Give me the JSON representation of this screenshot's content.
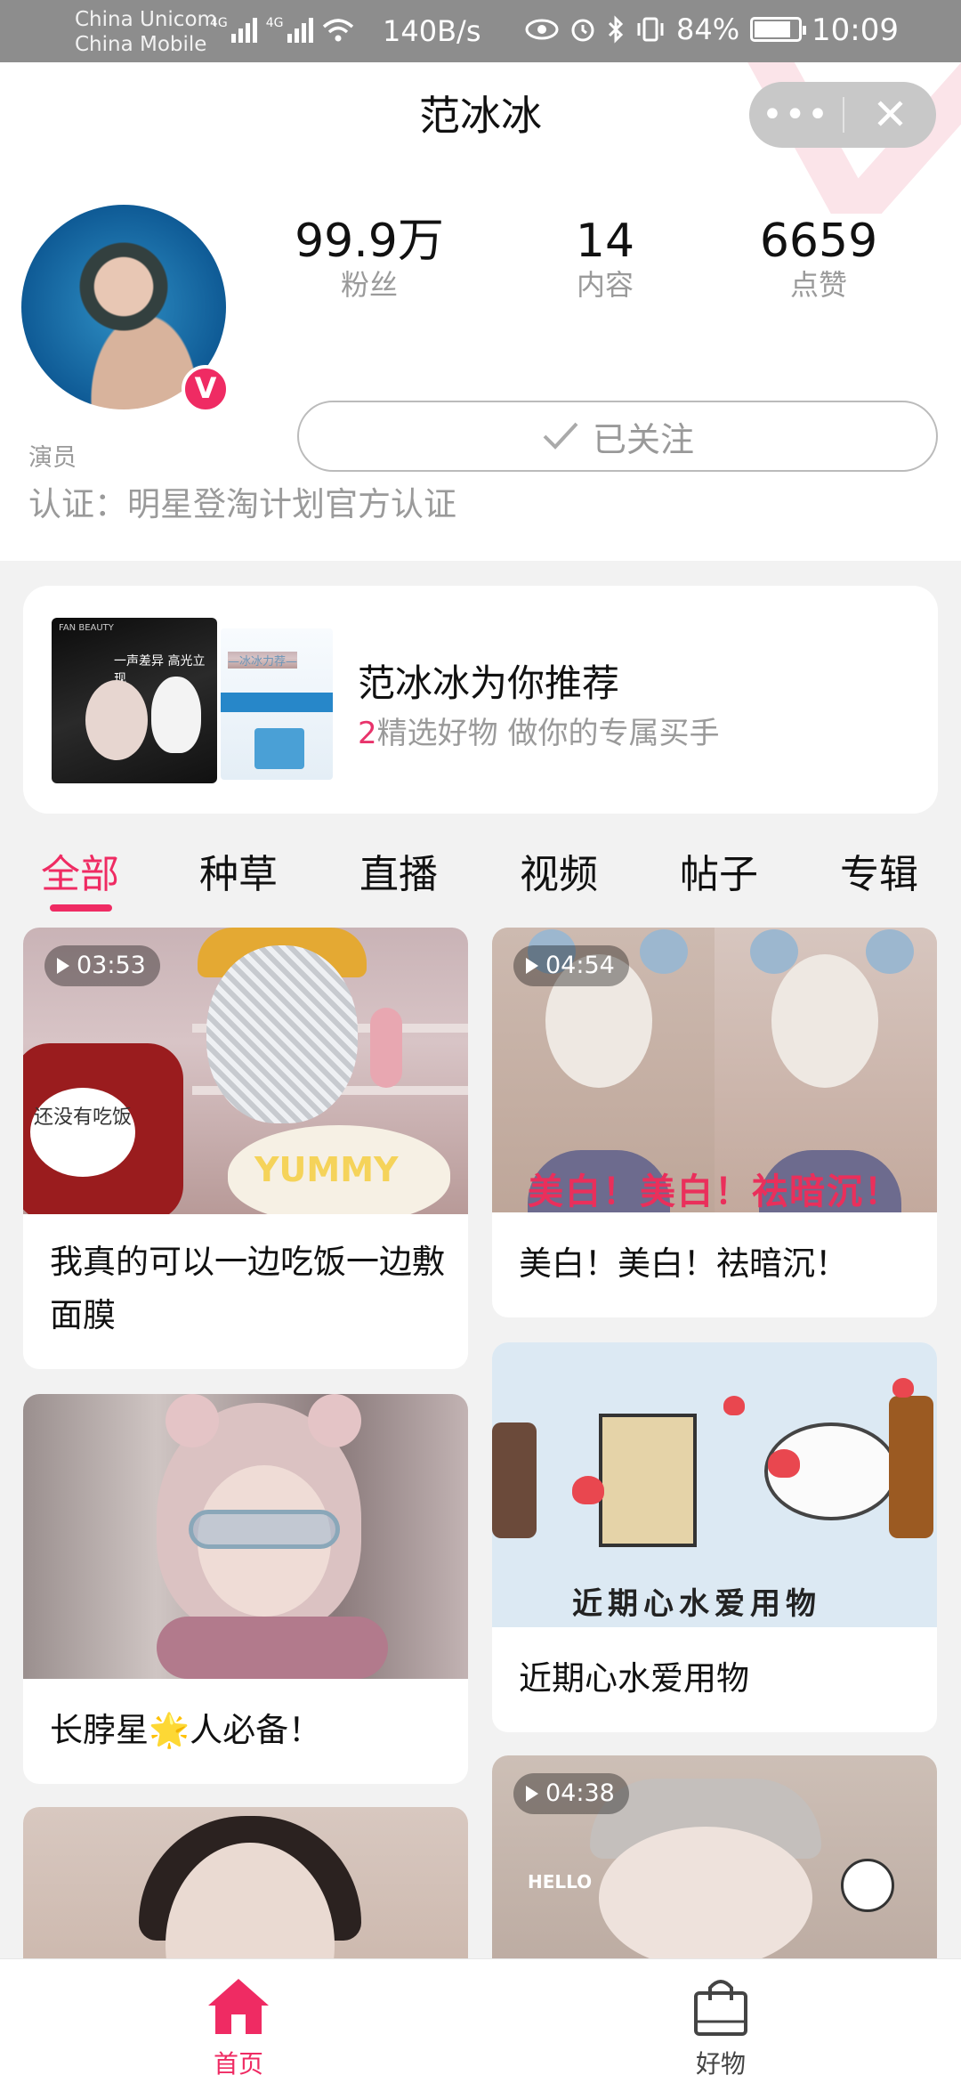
{
  "status_bar": {
    "carrier1": "China Unicom",
    "carrier2": "China Mobile",
    "net_type1": "4G",
    "net_type2": "4G",
    "speed": "140B/s",
    "battery_percent": "84%",
    "battery_level": 0.84,
    "time": "10:09"
  },
  "header": {
    "title": "范冰冰",
    "menu_label": "•••",
    "close_label": "✕"
  },
  "profile": {
    "verified_badge": "V",
    "stats": [
      {
        "value": "99.9万",
        "label": "粉丝"
      },
      {
        "value": "14",
        "label": "内容"
      },
      {
        "value": "6659",
        "label": "点赞"
      }
    ],
    "follow_button": "已关注",
    "role": "演员",
    "certification": "认证：明星登淘计划官方认证"
  },
  "recommendation": {
    "title": "范冰冰为你推荐",
    "count": "2",
    "subtitle": "精选好物  做你的专属买手",
    "image1_brand": "FAN BEAUTY",
    "image1_caption": "一声差异 高光立现",
    "image2_caption": "—冰冰力荐—"
  },
  "tabs": [
    "全部",
    "种草",
    "直播",
    "视频",
    "帖子",
    "专辑"
  ],
  "feed": [
    {
      "duration": "03:53",
      "title": "我真的可以一边吃饭一边敷面膜",
      "thumb_bubble": "还没有吃饭",
      "thumb_text": "YUMMY"
    },
    {
      "duration": "04:54",
      "title": "美白！美白！祛暗沉！",
      "thumb_text": "美白！美白！祛暗沉！"
    },
    {
      "title": "长脖星🌟人必备！"
    },
    {
      "title": "近期心水爱用物",
      "thumb_text": "近期心水爱用物"
    },
    {},
    {
      "duration": "04:38",
      "thumb_text": "HELLO"
    }
  ],
  "bottom_nav": [
    {
      "label": "首页",
      "icon": "home-icon",
      "color": "#ef2b63"
    },
    {
      "label": "好物",
      "icon": "shopping-bag-icon"
    }
  ],
  "colors": {
    "accent": "#ef2b63",
    "status_bar": "#8d8d8d"
  }
}
